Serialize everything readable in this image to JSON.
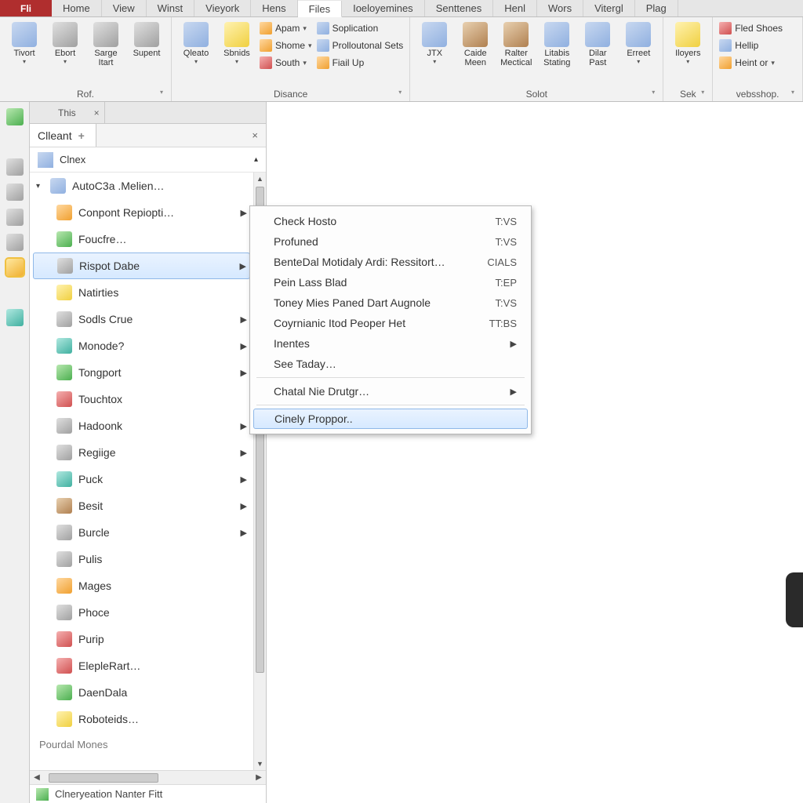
{
  "tabs": {
    "app": "Fli",
    "items": [
      "Home",
      "View",
      "Winst",
      "Vieyork",
      "Hens",
      "Files",
      "Ioeloyemines",
      "Senttenes",
      "Henl",
      "Wors",
      "Vitergl",
      "Plag"
    ],
    "active_index": 5
  },
  "ribbon": {
    "groups": [
      {
        "label": "Rof.",
        "big": [
          {
            "label": "Tivort",
            "dd": true
          },
          {
            "label": "Ebort",
            "dd": true
          },
          {
            "label": "Sarge Itart"
          },
          {
            "label": "Supent"
          }
        ]
      },
      {
        "label": "Disance",
        "big": [
          {
            "label": "Qleato",
            "dd": true
          },
          {
            "label": "Sbnids",
            "dd": true
          }
        ],
        "rows": [
          {
            "icon": "home-icon",
            "text": "Apam",
            "dd": true
          },
          {
            "icon": "house-icon",
            "text": "Shome",
            "dd": true
          },
          {
            "icon": "pin-icon",
            "text": "South",
            "dd": true
          }
        ],
        "rows2": [
          {
            "icon": "doc-icon",
            "text": "Soplication"
          },
          {
            "icon": "grid-icon",
            "text": "Prolloutonal Sets"
          },
          {
            "icon": "person-icon",
            "text": "Fiail Up"
          }
        ]
      },
      {
        "label": "Solot",
        "lead": {
          "label": "JTX",
          "dd": true
        },
        "big": [
          {
            "label": "Caide Meen"
          },
          {
            "label": "Ralter Mectical"
          },
          {
            "label": "Litabis Stating"
          },
          {
            "label": "Dilar Past"
          },
          {
            "label": "Erreet",
            "dd": true
          }
        ]
      },
      {
        "label": "Sek",
        "big": [
          {
            "label": "Iloyers",
            "dd": true
          }
        ]
      },
      {
        "label": "vebsshop.",
        "rows": [
          {
            "icon": "shoe-icon",
            "text": "Fled Shoes"
          },
          {
            "icon": "help-icon",
            "text": "Hellip"
          },
          {
            "icon": "book-icon",
            "text": "Heint or",
            "dd": true
          }
        ]
      }
    ]
  },
  "panel": {
    "tab1": "This",
    "tab2": "Clleant",
    "header": "Clnex",
    "root": "AutoC3a .Melien…",
    "items": [
      {
        "label": "Conpont Repiopti…",
        "sub": true,
        "ico": "c-orange"
      },
      {
        "label": "Foucfre…",
        "ico": "c-green"
      },
      {
        "label": "Rispot Dabe",
        "sub": true,
        "sel": true,
        "ico": "c-gray"
      },
      {
        "label": "Natirties",
        "ico": "c-yellow"
      },
      {
        "label": "Sodls Crue",
        "sub": true,
        "ico": "c-gray"
      },
      {
        "label": "Monode?",
        "sub": true,
        "ico": "c-teal"
      },
      {
        "label": "Tongport",
        "sub": true,
        "ico": "c-green"
      },
      {
        "label": "Touchtox",
        "ico": "c-red"
      },
      {
        "label": "Hadoonk",
        "sub": true,
        "ico": "c-gray"
      },
      {
        "label": "Regiige",
        "sub": true,
        "ico": "c-gray"
      },
      {
        "label": "Puck",
        "sub": true,
        "ico": "c-teal"
      },
      {
        "label": "Besit",
        "sub": true,
        "ico": "c-brown"
      },
      {
        "label": "Burcle",
        "sub": true,
        "ico": "c-gray"
      },
      {
        "label": "Pulis",
        "ico": "c-gray"
      },
      {
        "label": "Mages",
        "ico": "c-orange"
      },
      {
        "label": "Phoce",
        "ico": "c-gray"
      },
      {
        "label": "Purip",
        "ico": "c-red"
      },
      {
        "label": "ElepleRart…",
        "ico": "c-red"
      },
      {
        "label": "DaenDala",
        "ico": "c-green"
      },
      {
        "label": "Roboteids…",
        "ico": "c-yellow"
      }
    ],
    "section": "Pourdal Mones",
    "status": "Clneryeation Nanter  Fitt"
  },
  "context_menu": {
    "items": [
      {
        "label": "Check Hosto",
        "sc": "T:VS"
      },
      {
        "label": "Profuned",
        "sc": "T:VS"
      },
      {
        "label": "BenteDal Motidaly Ardi: Ressitort…",
        "sc": "CIALS"
      },
      {
        "label": "Pein Lass Blad",
        "sc": "T:EP"
      },
      {
        "label": "Toney Mies Paned Dart Augnole",
        "sc": "T:VS"
      },
      {
        "label": "Coyrnianic Itod Peoper Het",
        "sc": "TT:BS"
      },
      {
        "label": "Inentes",
        "arrow": true
      },
      {
        "label": "See Taday…"
      },
      {
        "sep": true
      },
      {
        "label": "Chatal Nie Drutgr…",
        "arrow": true
      },
      {
        "sep": true
      },
      {
        "label": "Cinely Proppor..",
        "hl": true
      }
    ]
  }
}
